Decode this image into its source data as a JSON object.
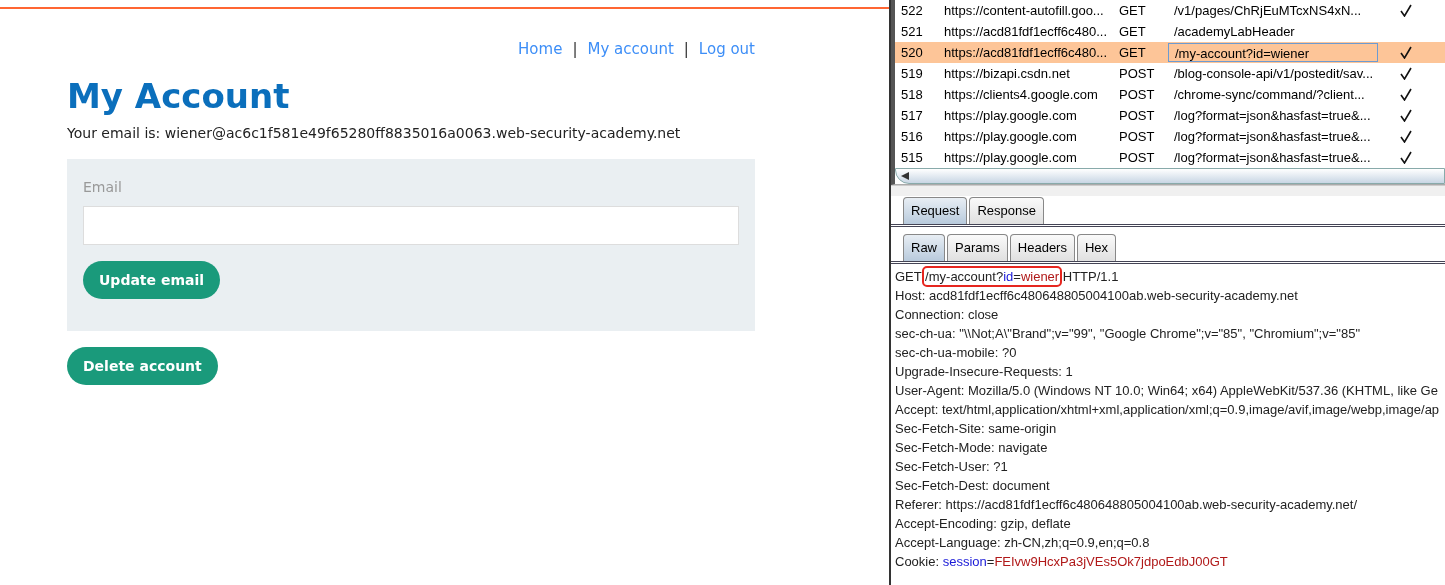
{
  "site": {
    "nav": [
      {
        "label": "Home"
      },
      {
        "label": "My account"
      },
      {
        "label": "Log out"
      }
    ],
    "separator": "|",
    "title": "My Account",
    "email_line": "Your email is: wiener@ac6c1f581e49f65280ff8835016a0063.web-security-academy.net",
    "form": {
      "label": "Email",
      "update_button": "Update email"
    },
    "delete_button": "Delete account"
  },
  "proxy": {
    "history": [
      {
        "number": "522",
        "host": "https://content-autofill.goo...",
        "method": "GET",
        "url": "/v1/pages/ChRjEuMTcxNS4xN...",
        "checked": true,
        "selected": false
      },
      {
        "number": "521",
        "host": "https://acd81fdf1ecff6c480...",
        "method": "GET",
        "url": "/academyLabHeader",
        "checked": false,
        "selected": false
      },
      {
        "number": "520",
        "host": "https://acd81fdf1ecff6c480...",
        "method": "GET",
        "url": "/my-account?id=wiener",
        "checked": true,
        "selected": true
      },
      {
        "number": "519",
        "host": "https://bizapi.csdn.net",
        "method": "POST",
        "url": "/blog-console-api/v1/postedit/sav...",
        "checked": true,
        "selected": false
      },
      {
        "number": "518",
        "host": "https://clients4.google.com",
        "method": "POST",
        "url": "/chrome-sync/command/?client...",
        "checked": true,
        "selected": false
      },
      {
        "number": "517",
        "host": "https://play.google.com",
        "method": "POST",
        "url": "/log?format=json&hasfast=true&...",
        "checked": true,
        "selected": false
      },
      {
        "number": "516",
        "host": "https://play.google.com",
        "method": "POST",
        "url": "/log?format=json&hasfast=true&...",
        "checked": true,
        "selected": false
      },
      {
        "number": "515",
        "host": "https://play.google.com",
        "method": "POST",
        "url": "/log?format=json&hasfast=true&...",
        "checked": true,
        "selected": false
      }
    ],
    "tabs": [
      {
        "label": "Request",
        "selected": true
      },
      {
        "label": "Response",
        "selected": false
      }
    ],
    "subtabs": [
      {
        "label": "Raw",
        "selected": true
      },
      {
        "label": "Params",
        "selected": false
      },
      {
        "label": "Headers",
        "selected": false
      },
      {
        "label": "Hex",
        "selected": false
      }
    ],
    "request": [
      [
        {
          "text": "GET ",
          "kind": "plain",
          "boxed": false
        },
        {
          "text": "/my-account?",
          "kind": "plain",
          "boxed": true
        },
        {
          "text": "id",
          "kind": "param-name",
          "boxed": true
        },
        {
          "text": "=",
          "kind": "plain",
          "boxed": true
        },
        {
          "text": "wiener",
          "kind": "param-value",
          "boxed": true
        },
        {
          "text": " HTTP/1.1",
          "kind": "plain",
          "boxed": false
        }
      ],
      [
        {
          "text": "Host: acd81fdf1ecff6c480648805004100ab.web-security-academy.net",
          "kind": "plain",
          "boxed": false
        }
      ],
      [
        {
          "text": "Connection: close",
          "kind": "plain",
          "boxed": false
        }
      ],
      [
        {
          "text": "sec-ch-ua: \"\\\\Not;A\\\"Brand\";v=\"99\", \"Google Chrome\";v=\"85\", \"Chromium\";v=\"85\"",
          "kind": "plain",
          "boxed": false
        }
      ],
      [
        {
          "text": "sec-ch-ua-mobile: ?0",
          "kind": "plain",
          "boxed": false
        }
      ],
      [
        {
          "text": "Upgrade-Insecure-Requests: 1",
          "kind": "plain",
          "boxed": false
        }
      ],
      [
        {
          "text": "User-Agent: Mozilla/5.0 (Windows NT 10.0; Win64; x64) AppleWebKit/537.36 (KHTML, like Ge",
          "kind": "plain",
          "boxed": false
        }
      ],
      [
        {
          "text": "Accept: text/html,application/xhtml+xml,application/xml;q=0.9,image/avif,image/webp,image/ap",
          "kind": "plain",
          "boxed": false
        }
      ],
      [
        {
          "text": "Sec-Fetch-Site: same-origin",
          "kind": "plain",
          "boxed": false
        }
      ],
      [
        {
          "text": "Sec-Fetch-Mode: navigate",
          "kind": "plain",
          "boxed": false
        }
      ],
      [
        {
          "text": "Sec-Fetch-User: ?1",
          "kind": "plain",
          "boxed": false
        }
      ],
      [
        {
          "text": "Sec-Fetch-Dest: document",
          "kind": "plain",
          "boxed": false
        }
      ],
      [
        {
          "text": "Referer: https://acd81fdf1ecff6c480648805004100ab.web-security-academy.net/",
          "kind": "plain",
          "boxed": false
        }
      ],
      [
        {
          "text": "Accept-Encoding: gzip, deflate",
          "kind": "plain",
          "boxed": false
        }
      ],
      [
        {
          "text": "Accept-Language: zh-CN,zh;q=0.9,en;q=0.8",
          "kind": "plain",
          "boxed": false
        }
      ],
      [
        {
          "text": "Cookie: ",
          "kind": "plain",
          "boxed": false
        },
        {
          "text": "session",
          "kind": "param-name",
          "boxed": false
        },
        {
          "text": "=",
          "kind": "plain",
          "boxed": false
        },
        {
          "text": "FEIvw9HcxPa3jVEs5Ok7jdpoEdbJ00GT",
          "kind": "param-value",
          "boxed": false
        }
      ]
    ]
  }
}
